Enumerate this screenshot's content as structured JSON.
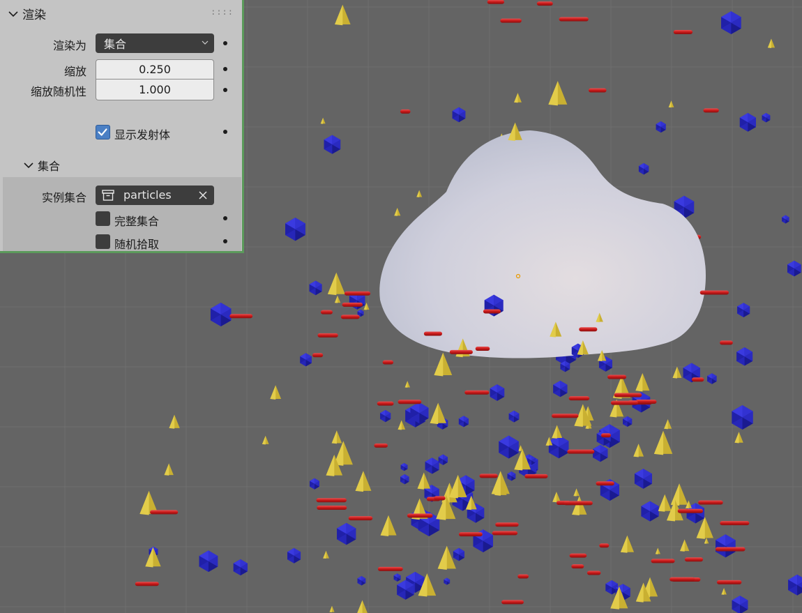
{
  "panel": {
    "section_title": "渲染",
    "render_as": {
      "label": "渲染为",
      "value": "集合"
    },
    "scale": {
      "label": "缩放",
      "value": "0.250"
    },
    "scale_random": {
      "label": "缩放随机性",
      "value": "1.000"
    },
    "show_emitter": {
      "label": "显示发射体",
      "checked": true
    },
    "collection_subpanel": {
      "title": "集合",
      "instance_collection": {
        "label": "实例集合",
        "value": "particles"
      },
      "whole_collection": {
        "label": "完整集合",
        "checked": false
      },
      "pick_random": {
        "label": "随机拾取",
        "checked": false
      }
    }
  },
  "icons": {
    "section_chevron": "chevron-down-icon",
    "drag_handle": "drag-grip-icon",
    "dropdown_arrow": "chevron-down-icon",
    "collection": "collection-box-icon",
    "clear": "close-icon",
    "checkmark": "checkmark-icon",
    "keyframe": "keyframe-dot-icon"
  },
  "colors": {
    "viewport_bg": "#646464",
    "grid": "#6e6e6e",
    "panel_bg": "#c4c4c4",
    "panel_focus_border": "#5b9a5b",
    "checkbox_on": "#4a7fc4",
    "field_dark": "#3d3d3d",
    "particle_blue": "#2a2ac8",
    "particle_yellow": "#d9c33a",
    "particle_red": "#d02020",
    "emitter": "#d9d9e4"
  }
}
